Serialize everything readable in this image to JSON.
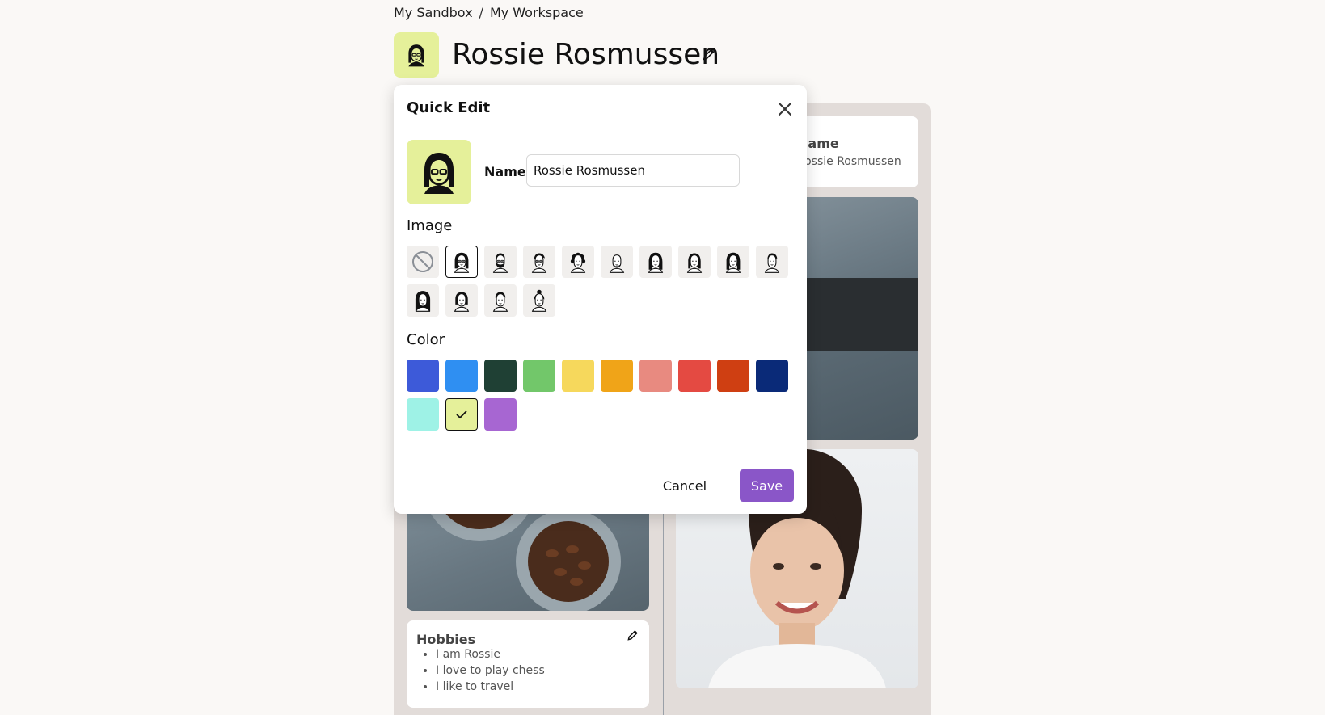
{
  "breadcrumb": {
    "root": "My Sandbox",
    "separator": "/",
    "current": "My Workspace"
  },
  "header": {
    "title": "Rossie Rosmussen",
    "avatar_color": "#e5f09a"
  },
  "board": {
    "name_card": {
      "title": "Name",
      "value": "Rossie Rosmussen"
    },
    "hobbies": {
      "title": "Hobbies",
      "items": [
        "I am Rossie",
        "I love to play chess",
        "I like to travel"
      ]
    }
  },
  "dialog": {
    "title": "Quick Edit",
    "name_label": "Name",
    "name_value": "Rossie Rosmussen",
    "image_label": "Image",
    "color_label": "Color",
    "cancel_label": "Cancel",
    "save_label": "Save",
    "images": [
      {
        "icon": "no-image-icon"
      },
      {
        "icon": "avatar-glasses-woman-icon",
        "selected": true
      },
      {
        "icon": "avatar-bearded-man-icon"
      },
      {
        "icon": "avatar-glasses-man-icon"
      },
      {
        "icon": "avatar-curly-hair-icon"
      },
      {
        "icon": "avatar-bald-man-icon"
      },
      {
        "icon": "avatar-long-hair-woman-icon"
      },
      {
        "icon": "avatar-woman-icon"
      },
      {
        "icon": "avatar-woman-2-icon"
      },
      {
        "icon": "avatar-man-icon"
      },
      {
        "icon": "avatar-hijab-woman-icon"
      },
      {
        "icon": "avatar-bob-hair-woman-icon"
      },
      {
        "icon": "avatar-young-man-icon"
      },
      {
        "icon": "avatar-bun-woman-icon"
      }
    ],
    "colors": [
      {
        "hex": "#3d5ad9"
      },
      {
        "hex": "#2f8ff2"
      },
      {
        "hex": "#1f4034"
      },
      {
        "hex": "#72c76a"
      },
      {
        "hex": "#f6d85c"
      },
      {
        "hex": "#f0a418"
      },
      {
        "hex": "#e88a80"
      },
      {
        "hex": "#e44a42"
      },
      {
        "hex": "#cf3f12"
      },
      {
        "hex": "#0a2a78"
      },
      {
        "hex": "#9ef2e6"
      },
      {
        "hex": "#e5f09a",
        "selected": true
      },
      {
        "hex": "#a766d2"
      }
    ]
  }
}
